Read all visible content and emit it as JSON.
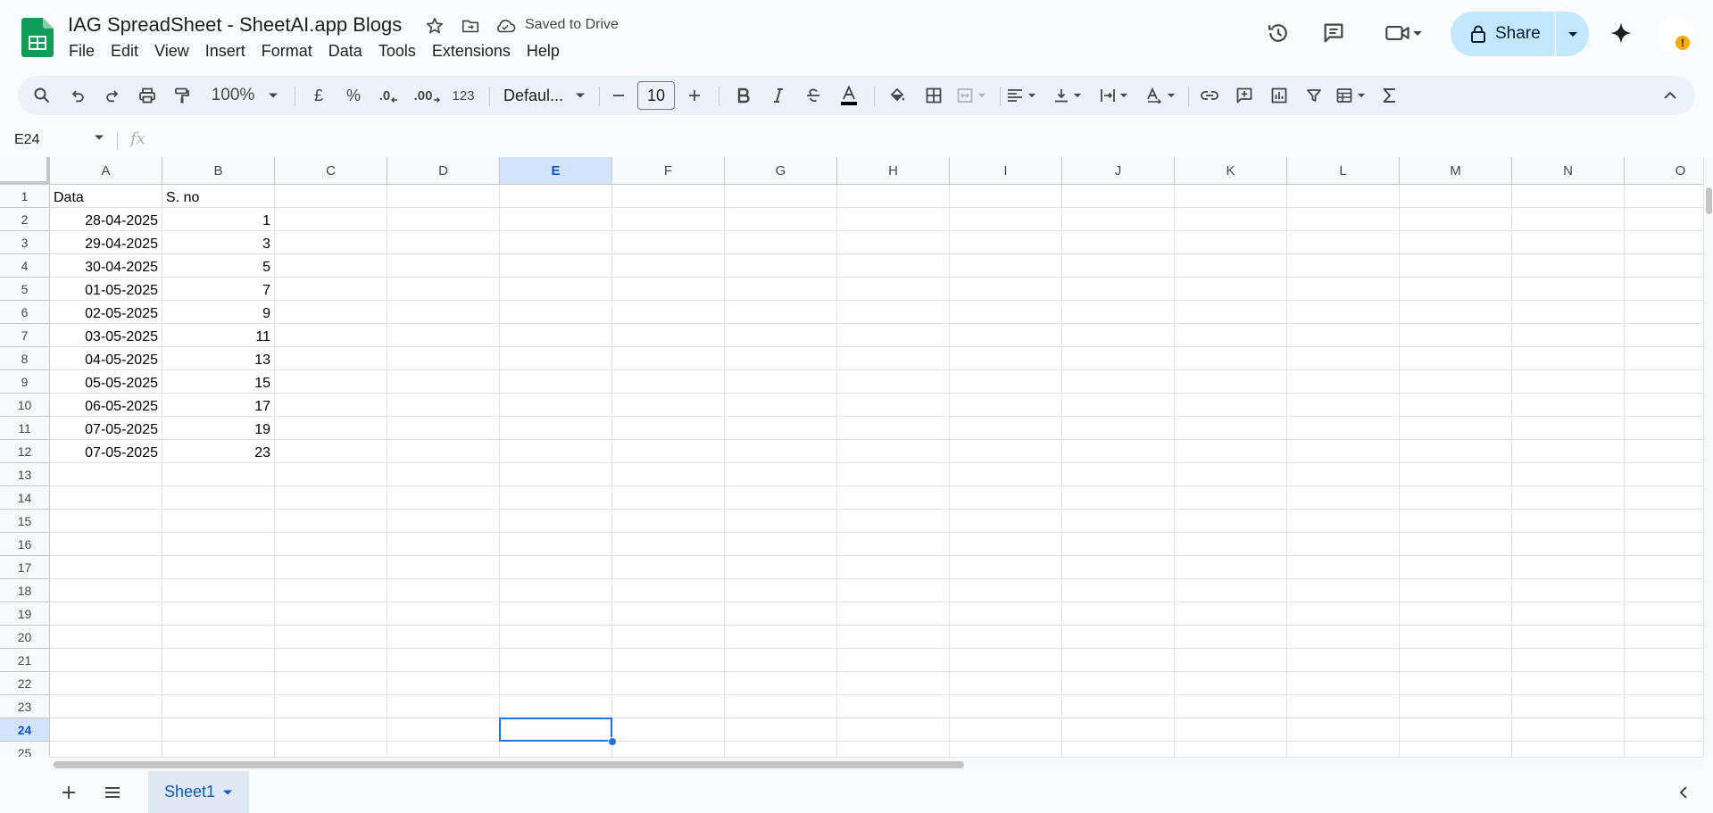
{
  "header": {
    "title": "IAG SpreadSheet - SheetAI.app Blogs",
    "saved_status": "Saved to Drive",
    "menu": [
      "File",
      "Edit",
      "View",
      "Insert",
      "Format",
      "Data",
      "Tools",
      "Extensions",
      "Help"
    ],
    "share_label": "Share",
    "avatar_alert": "!"
  },
  "toolbar": {
    "zoom": "100%",
    "currency": "£",
    "percent": "%",
    "dec_decrease": ".0",
    "dec_increase": ".00",
    "number_format": "123",
    "font_name": "Defaul...",
    "font_size": "10"
  },
  "formula_bar": {
    "name_box": "E24",
    "fx": "fx"
  },
  "grid": {
    "columns": [
      "A",
      "B",
      "C",
      "D",
      "E",
      "F",
      "G",
      "H",
      "I",
      "J",
      "K",
      "L",
      "M",
      "N",
      "O"
    ],
    "selected_column": "E",
    "row_numbers": [
      "1",
      "2",
      "3",
      "4",
      "5",
      "6",
      "7",
      "8",
      "9",
      "10",
      "11",
      "12",
      "13",
      "14",
      "15",
      "16",
      "17",
      "18",
      "19",
      "20",
      "21",
      "22",
      "23",
      "24",
      "25"
    ],
    "selected_row": "24",
    "rows": [
      [
        "Data",
        "S. no"
      ],
      [
        "28-04-2025",
        "1"
      ],
      [
        "29-04-2025",
        "3"
      ],
      [
        "30-04-2025",
        "5"
      ],
      [
        "01-05-2025",
        "7"
      ],
      [
        "02-05-2025",
        "9"
      ],
      [
        "03-05-2025",
        "11"
      ],
      [
        "04-05-2025",
        "13"
      ],
      [
        "05-05-2025",
        "15"
      ],
      [
        "06-05-2025",
        "17"
      ],
      [
        "07-05-2025",
        "19"
      ],
      [
        "07-05-2025",
        "23"
      ]
    ]
  },
  "bottom": {
    "sheet_tab": "Sheet1"
  },
  "colors": {
    "accent": "#0b57d0",
    "share_bg": "#c2e7ff",
    "sheets_green": "#0f9d58",
    "selection": "#1a73e8"
  }
}
